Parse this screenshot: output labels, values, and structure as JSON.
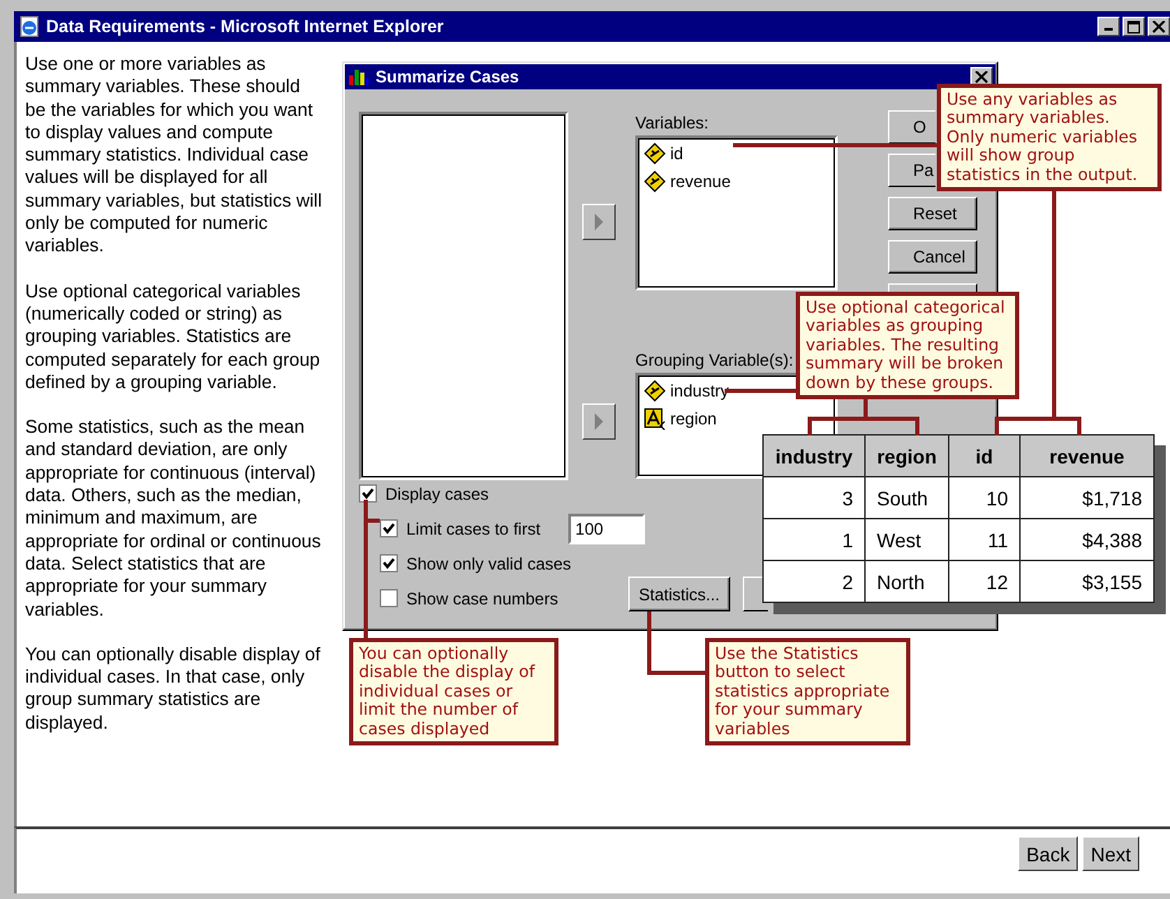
{
  "window": {
    "title": "Data Requirements - Microsoft Internet Explorer"
  },
  "help_paragraphs": [
    "Use one or more variables as summary variables. These should be the variables for which you want to display values and compute summary statistics. Individual case values will be displayed for all summary variables, but statistics will only be computed for numeric variables.",
    "Use optional categorical variables (numerically coded or string) as grouping variables. Statistics are computed separately for each group defined by a grouping variable.",
    "Some statistics, such as the mean and standard deviation, are only appropriate for continuous (interval) data. Others, such as the median, minimum and maximum, are appropriate for ordinal or continuous data. Select statistics that are appropriate for your summary variables.",
    "You can optionally disable display of individual cases. In that case, only group summary statistics are displayed."
  ],
  "dialog": {
    "title": "Summarize Cases",
    "variables_label": "Variables:",
    "variables": [
      {
        "name": "id",
        "kind": "numeric"
      },
      {
        "name": "revenue",
        "kind": "numeric"
      }
    ],
    "grouping_label": "Grouping Variable(s):",
    "grouping_variables": [
      {
        "name": "industry",
        "kind": "numeric"
      },
      {
        "name": "region",
        "kind": "string"
      }
    ],
    "buttons": [
      "O",
      "Pa",
      "Reset",
      "Cancel"
    ],
    "options": [
      {
        "label": "Display cases",
        "checked": true,
        "children": [
          {
            "label": "Limit cases to first",
            "checked": true,
            "value": "100"
          },
          {
            "label": "Show only valid cases",
            "checked": true
          },
          {
            "label": "Show case numbers",
            "checked": false
          }
        ]
      }
    ],
    "statistics_button": "Statistics..."
  },
  "output_table": {
    "columns": [
      "industry",
      "region",
      "id",
      "revenue"
    ],
    "rows": [
      [
        "3",
        "South",
        "10",
        "$1,718"
      ],
      [
        "1",
        "West",
        "11",
        "$4,388"
      ],
      [
        "2",
        "North",
        "12",
        "$3,155"
      ]
    ]
  },
  "callouts": [
    "Use any variables as summary variables. Only numeric variables will show group statistics in the output.",
    "Use optional categorical variables as grouping variables. The resulting summary will be broken down by these groups.",
    "You can optionally disable the display of individual cases or limit the number of cases displayed",
    "Use the Statistics button to select statistics appropriate for your summary variables"
  ],
  "nav_buttons": [
    "Back",
    "Next"
  ]
}
